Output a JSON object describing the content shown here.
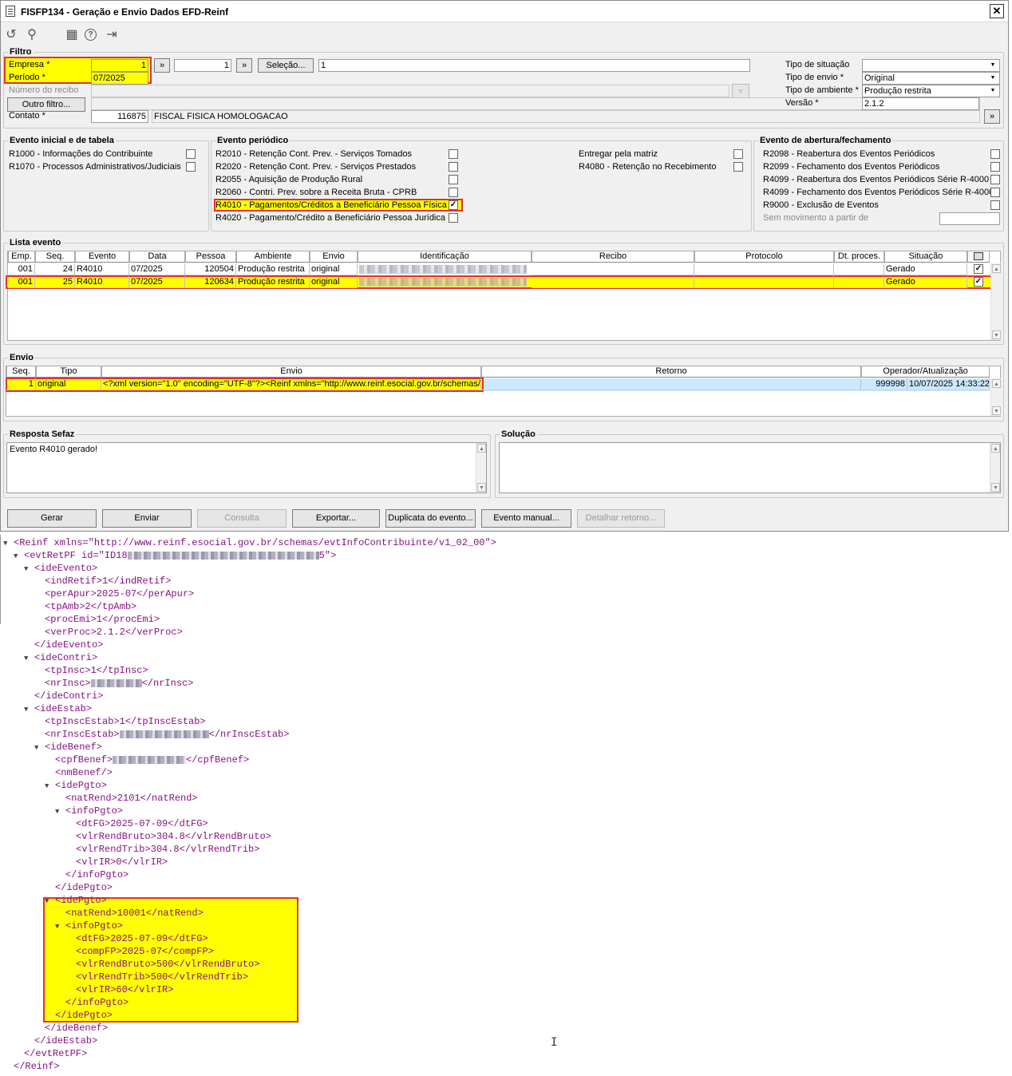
{
  "window": {
    "title": "FISFP134 - Geração e Envio Dados EFD-Reinf",
    "close": "✕"
  },
  "toolbar": [
    {
      "name": "refresh-icon",
      "glyph": "↺"
    },
    {
      "name": "search-icon",
      "glyph": "⚲"
    },
    {
      "name": "calendar-icon",
      "glyph": "▦"
    },
    {
      "name": "help-icon",
      "glyph": "?"
    },
    {
      "name": "exit-icon",
      "glyph": "⇥"
    }
  ],
  "filtro": {
    "title": "Filtro",
    "empresa_label": "Empresa *",
    "empresa_value": "1",
    "next_btn": "»",
    "empresa2_value": "1",
    "selecao_btn": "Seleção...",
    "selecao_value": "1",
    "periodo_label": "Período *",
    "periodo_value": "07/2025",
    "recibo_label": "Número do recibo",
    "outro_filtro_btn": "Outro filtro...",
    "contato_label": "Contato *",
    "contato_value": "116875",
    "contato_nome": "FISCAL FISICA HOMOLOGACAO",
    "tipo_situacao_label": "Tipo de situação",
    "tipo_situacao_value": "",
    "tipo_envio_label": "Tipo de envio *",
    "tipo_envio_value": "Original",
    "tipo_ambiente_label": "Tipo de ambiente *",
    "tipo_ambiente_value": "Produção restrita",
    "versao_label": "Versão *",
    "versao_value": "2.1.2"
  },
  "evento_inicial": {
    "title": "Evento inicial e de tabela",
    "items": [
      {
        "label": "R1000 - Informações do Contribuinte",
        "checked": false
      },
      {
        "label": "R1070 - Processos Administrativos/Judiciais",
        "checked": false
      }
    ]
  },
  "evento_periodico": {
    "title": "Evento periódico",
    "items": [
      {
        "label": "R2010 - Retenção Cont. Prev. - Serviços Tomados",
        "checked": false
      },
      {
        "label": "R2020 - Retenção Cont. Prev. - Serviços Prestados",
        "checked": false
      },
      {
        "label": "R2055 - Aquisição de Produção Rural",
        "checked": false
      },
      {
        "label": "R2060 - Contri. Prev. sobre a Receita Bruta - CPRB",
        "checked": false
      },
      {
        "label": "R4010 - Pagamentos/Créditos a Beneficiário Pessoa Física",
        "checked": true
      },
      {
        "label": "R4020 - Pagamento/Crédito a Beneficiário Pessoa Jurídica",
        "checked": false
      }
    ],
    "right_items": [
      {
        "label": "Entregar pela matriz",
        "checked": false
      },
      {
        "label": "R4080 - Retenção no Recebimento",
        "checked": false
      }
    ]
  },
  "evento_abertura": {
    "title": "Evento de abertura/fechamento",
    "items": [
      {
        "label": "R2098 - Reabertura dos Eventos Periódicos",
        "checked": false
      },
      {
        "label": "R2099 - Fechamento dos Eventos Periódicos",
        "checked": false
      },
      {
        "label": "R4099 - Reabertura dos Eventos Periódicos Série R-4000",
        "checked": false
      },
      {
        "label": "R4099 - Fechamento dos Eventos Periódicos Série R-4000",
        "checked": false
      },
      {
        "label": "R9000 - Exclusão de Eventos",
        "checked": false
      }
    ],
    "sem_movimento_label": "Sem movimento a partir de"
  },
  "lista_evento": {
    "title": "Lista evento",
    "columns": [
      "Emp.",
      "Seq.",
      "Evento",
      "Data",
      "Pessoa",
      "Ambiente",
      "Envio",
      "Identificação",
      "Recibo",
      "Protocolo",
      "Dt. proces.",
      "Situação"
    ],
    "rows": [
      {
        "emp": "001",
        "seq": "24",
        "evento": "R4010",
        "data": "07/2025",
        "pessoa": "120504",
        "ambiente": "Produção restrita",
        "envio": "original",
        "situacao": "Gerado",
        "checked": true
      },
      {
        "emp": "001",
        "seq": "25",
        "evento": "R4010",
        "data": "07/2025",
        "pessoa": "120634",
        "ambiente": "Produção restrita",
        "envio": "original",
        "situacao": "Gerado",
        "checked": true
      }
    ]
  },
  "envio": {
    "title": "Envio",
    "columns": [
      "Seq.",
      "Tipo",
      "Envio",
      "Retorno",
      "Operador/Atualização"
    ],
    "row": {
      "seq": "1",
      "tipo": "original",
      "envio": "<?xml version=\"1.0\" encoding=\"UTF-8\"?><Reinf xmlns=\"http://www.reinf.esocial.gov.br/schemas/",
      "operador": "999998",
      "atualizacao": "10/07/2025 14:33:22"
    }
  },
  "resposta": {
    "title": "Resposta Sefaz",
    "text": "Evento R4010 gerado!"
  },
  "solucao": {
    "title": "Solução",
    "text": ""
  },
  "buttons": {
    "gerar": "Gerar",
    "enviar": "Enviar",
    "consulta": "Consulta",
    "exportar": "Exportar...",
    "duplicata": "Duplicata do evento...",
    "evento_manual": "Evento manual...",
    "detalhar": "Detalhar retorno..."
  },
  "xml": [
    {
      "tri": true,
      "t": "<Reinf xmlns=\"http://www.reinf.esocial.gov.br/schemas/evtInfoContribuinte/v1_02_00\">"
    },
    {
      "tri": true,
      "t": "<evtRetPF id=\"ID18",
      "blur": 240,
      "after": "5\">"
    },
    {
      "tri": true,
      "t": "<ideEvento>"
    },
    {
      "t": "<indRetif>1</indRetif>"
    },
    {
      "t": "<perApur>2025-07</perApur>"
    },
    {
      "t": "<tpAmb>2</tpAmb>"
    },
    {
      "t": "<procEmi>1</procEmi>"
    },
    {
      "t": "<verProc>2.1.2</verProc>"
    },
    {
      "t": "</ideEvento>"
    },
    {
      "tri": true,
      "t": "<ideContri>"
    },
    {
      "t": "<tpInsc>1</tpInsc>"
    },
    {
      "t": "<nrInsc>",
      "blur": 64,
      "after": "</nrInsc>"
    },
    {
      "t": "</ideContri>"
    },
    {
      "tri": true,
      "t": "<ideEstab>"
    },
    {
      "t": "<tpInscEstab>1</tpInscEstab>"
    },
    {
      "t": "<nrInscEstab>",
      "blur": 112,
      "after": "</nrInscEstab>"
    },
    {
      "tri": true,
      "t": "<ideBenef>"
    },
    {
      "t": "<cpfBenef>",
      "blur": 92,
      "after": "</cpfBenef>"
    },
    {
      "t": "<nmBenef/>"
    },
    {
      "tri": true,
      "t": "<idePgto>"
    },
    {
      "t": "<natRend>2101</natRend>"
    },
    {
      "tri": true,
      "t": "<infoPgto>"
    },
    {
      "t": "<dtFG>2025-07-09</dtFG>"
    },
    {
      "t": "<vlrRendBruto>304.8</vlrRendBruto>"
    },
    {
      "t": "<vlrRendTrib>304.8</vlrRendTrib>"
    },
    {
      "t": "<vlrIR>0</vlrIR>"
    },
    {
      "t": "</infoPgto>"
    },
    {
      "t": "</idePgto>"
    },
    {
      "tri": true,
      "t": "<idePgto>"
    },
    {
      "t": "<natRend>10001</natRend>"
    },
    {
      "tri": true,
      "t": "<infoPgto>"
    },
    {
      "t": "<dtFG>2025-07-09</dtFG>"
    },
    {
      "t": "<compFP>2025-07</compFP>"
    },
    {
      "t": "<vlrRendBruto>500</vlrRendBruto>"
    },
    {
      "t": "<vlrRendTrib>500</vlrRendTrib>"
    },
    {
      "t": "<vlrIR>60</vlrIR>"
    },
    {
      "t": "</infoPgto>"
    },
    {
      "t": "</idePgto>"
    },
    {
      "t": "</ideBenef>"
    },
    {
      "t": "</ideEstab>"
    },
    {
      "t": "</evtRetPF>"
    },
    {
      "t": "</Reinf>"
    }
  ],
  "colors": {
    "highlight": "#ffff00",
    "redbox": "#e53030",
    "selected_row": "#cce8ff",
    "xml_tag": "#881280"
  }
}
